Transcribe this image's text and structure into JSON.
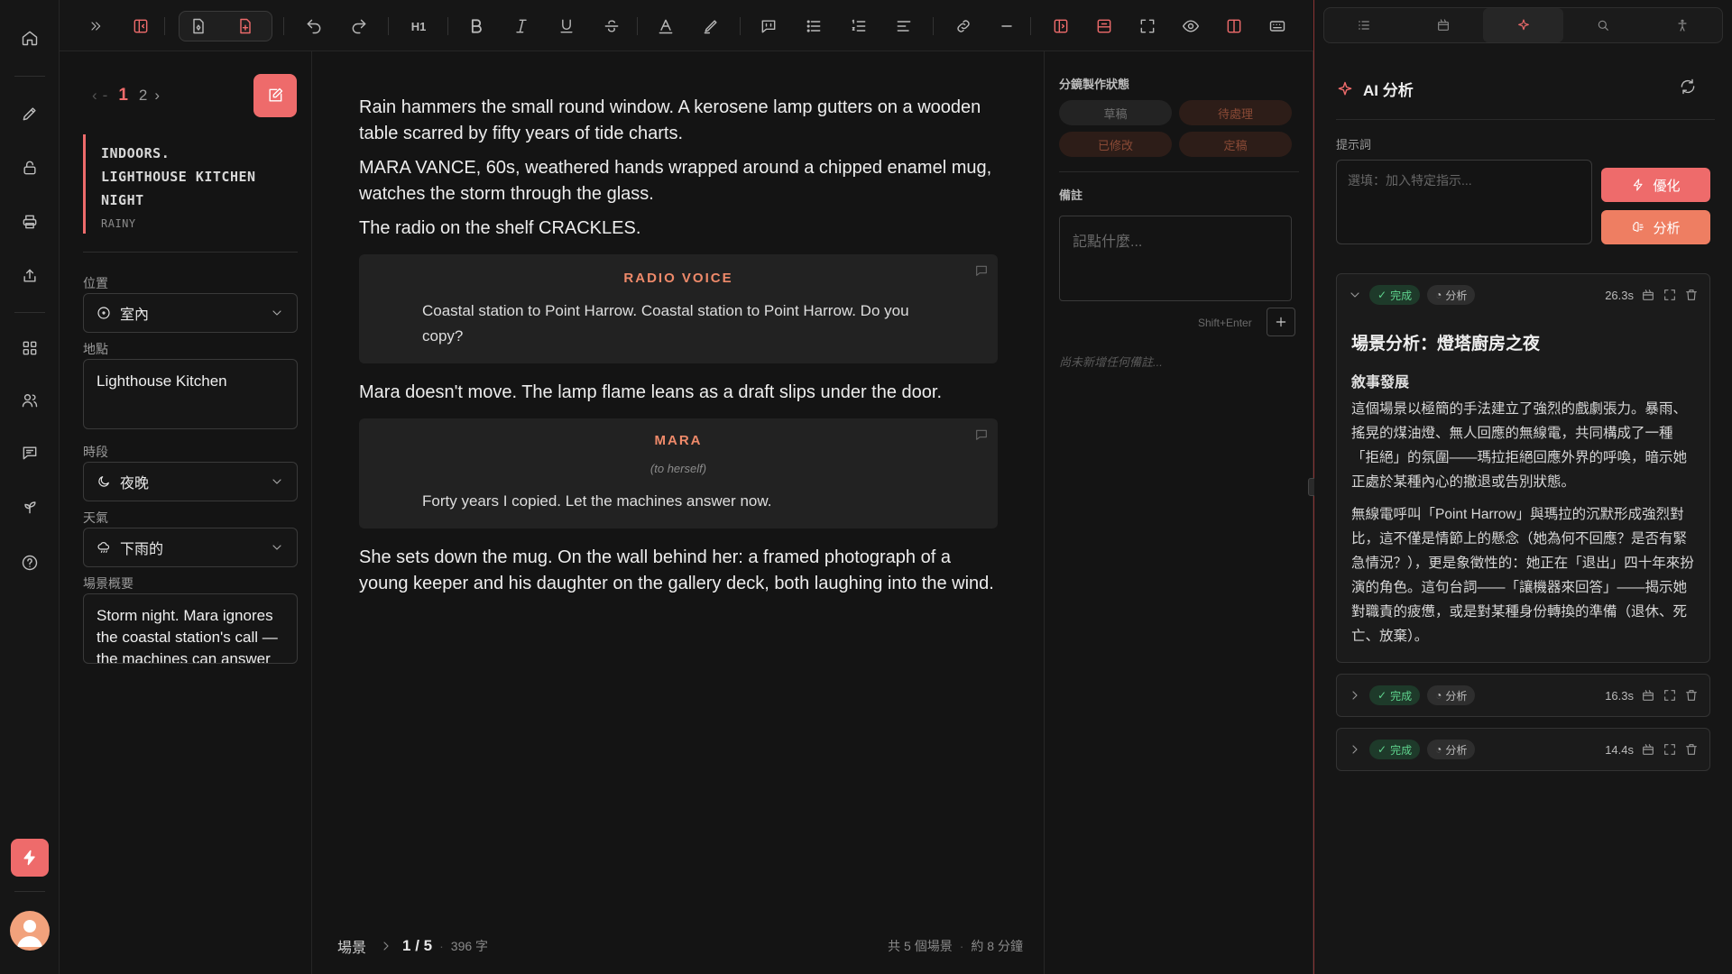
{
  "toolbar": {
    "heading_label": "H1"
  },
  "meta": {
    "pager": {
      "current": "1",
      "next": "2"
    },
    "slug": {
      "line1": "INDOORS.",
      "line2": "LIGHTHOUSE KITCHEN",
      "line3": "NIGHT",
      "sub": "RAINY"
    },
    "location_type": {
      "label": "位置",
      "value": "室內"
    },
    "place": {
      "label": "地點",
      "value": "Lighthouse Kitchen"
    },
    "time": {
      "label": "時段",
      "value": "夜晚"
    },
    "weather": {
      "label": "天氣",
      "value": "下雨的"
    },
    "summary": {
      "label": "場景概要",
      "value": "Storm night. Mara ignores the coastal station's call — the machines can answer now."
    }
  },
  "editor": {
    "action1": "Rain hammers the small round window. A kerosene lamp gutters on a wooden table scarred by fifty years of tide charts.",
    "action2": "MARA VANCE, 60s, weathered hands wrapped around a chipped enamel mug, watches the storm through the glass.",
    "action3": "The radio on the shelf CRACKLES.",
    "dialog1": {
      "name": "RADIO VOICE",
      "line": "Coastal station to Point Harrow. Coastal station to Point Harrow. Do you copy?"
    },
    "action4": "Mara doesn't move. The lamp flame leans as a draft slips under the door.",
    "dialog2": {
      "name": "MARA",
      "paren": "(to herself)",
      "line": "Forty years I copied. Let the machines answer now."
    },
    "action5": "She sets down the mug. On the wall behind her: a framed photograph of a young keeper and his daughter on the gallery deck, both laughing into the wind.",
    "status": {
      "scene": "場景",
      "position": "1 / 5",
      "words": "396 字",
      "total": "共 5 個場景",
      "duration": "約 8 分鐘"
    }
  },
  "notes": {
    "status_title": "分鏡製作狀態",
    "chips": [
      "草稿",
      "待處理",
      "已修改",
      "定稿"
    ],
    "notes_title": "備註",
    "placeholder": "記點什麼...",
    "hint": "Shift+Enter",
    "empty": "尚未新增任何備註..."
  },
  "ai": {
    "title": "AI 分析",
    "prompt_label": "提示詞",
    "prompt_placeholder": "選填：加入特定指示...",
    "optimize_label": "優化",
    "analyze_label": "分析",
    "cards": [
      {
        "status": "完成",
        "type": "分析",
        "time": "26.3s",
        "title": "場景分析：燈塔廚房之夜",
        "section": "敘事發展",
        "p1": "這個場景以極簡的手法建立了強烈的戲劇張力。暴雨、搖晃的煤油燈、無人回應的無線電，共同構成了一種「拒絕」的氛圍——瑪拉拒絕回應外界的呼喚，暗示她正處於某種內心的撤退或告別狀態。",
        "p2": "無線電呼叫「Point Harrow」與瑪拉的沉默形成強烈對比，這不僅是情節上的懸念（她為何不回應？是否有緊急情況？），更是象徵性的：她正在「退出」四十年來扮演的角色。這句台詞——「讓機器來回答」——揭示她對職責的疲憊，或是對某種身份轉換的準備（退休、死亡、放棄）。"
      },
      {
        "status": "完成",
        "type": "分析",
        "time": "16.3s"
      },
      {
        "status": "完成",
        "type": "分析",
        "time": "14.4s"
      }
    ]
  }
}
